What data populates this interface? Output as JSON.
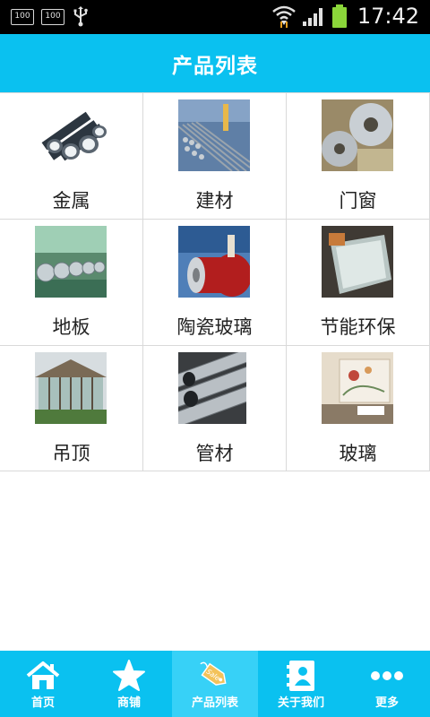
{
  "status_bar": {
    "battery_left_1": "100",
    "battery_left_2": "100",
    "time": "17:42",
    "icons": [
      "battery-icon",
      "battery-icon",
      "usb-icon",
      "wifi-icon",
      "signal-icon",
      "battery-icon"
    ]
  },
  "header": {
    "title": "产品列表"
  },
  "products": [
    {
      "label": "金属",
      "icon": "steel-pipes-image"
    },
    {
      "label": "建材",
      "icon": "steel-bars-image"
    },
    {
      "label": "门窗",
      "icon": "steel-coils-image"
    },
    {
      "label": "地板",
      "icon": "factory-coils-image"
    },
    {
      "label": "陶瓷玻璃",
      "icon": "red-coil-image"
    },
    {
      "label": "节能环保",
      "icon": "glass-image"
    },
    {
      "label": "吊顶",
      "icon": "sunroom-image"
    },
    {
      "label": "管材",
      "icon": "tubes-image"
    },
    {
      "label": "玻璃",
      "icon": "decorative-glass-image"
    }
  ],
  "bottom_nav": {
    "items": [
      {
        "label": "首页",
        "icon": "home-icon"
      },
      {
        "label": "商铺",
        "icon": "star-icon"
      },
      {
        "label": "产品列表",
        "icon": "sale-tag-icon",
        "active": true
      },
      {
        "label": "关于我们",
        "icon": "contact-card-icon"
      },
      {
        "label": "更多",
        "icon": "more-icon"
      }
    ]
  },
  "colors": {
    "accent": "#0ac1f0",
    "active_tab": "#37d1f7"
  }
}
